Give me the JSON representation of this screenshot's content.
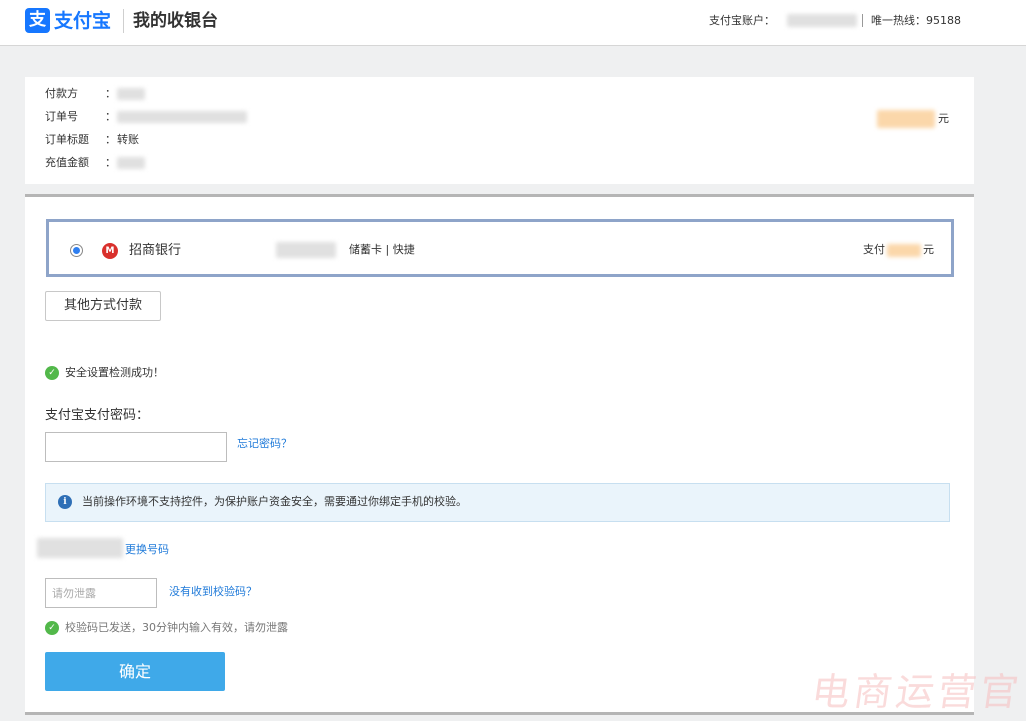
{
  "header": {
    "logo_mark": "支",
    "logo_text": "支付宝",
    "cashier_title": "我的收银台",
    "account_label": "支付宝账户：",
    "hotline": "唯一热线：95188"
  },
  "order": {
    "payer_label": "付款方",
    "order_no_label": "订单号",
    "order_title_label": "订单标题",
    "order_title_value": "转账",
    "recharge_label": "充值金额",
    "colon": "：",
    "currency": "元"
  },
  "bank": {
    "name": "招商银行",
    "card_type": "储蓄卡 | 快捷",
    "pay_label": "支付",
    "currency": "元"
  },
  "other_method_button": "其他方式付款",
  "security_check": "安全设置检测成功！",
  "password": {
    "label": "支付宝支付密码：",
    "forgot_link": "忘记密码？"
  },
  "info_notice": "当前操作环境不支持控件，为保护账户资金安全，需要通过你绑定手机的校验。",
  "phone": {
    "change_link": "更换号码"
  },
  "verification": {
    "placeholder": "请勿泄露",
    "no_code_link": "没有收到校验码？",
    "sent_notice": "校验码已发送，30分钟内输入有效，请勿泄露"
  },
  "confirm_button": "确定",
  "watermark": "电商运营官"
}
